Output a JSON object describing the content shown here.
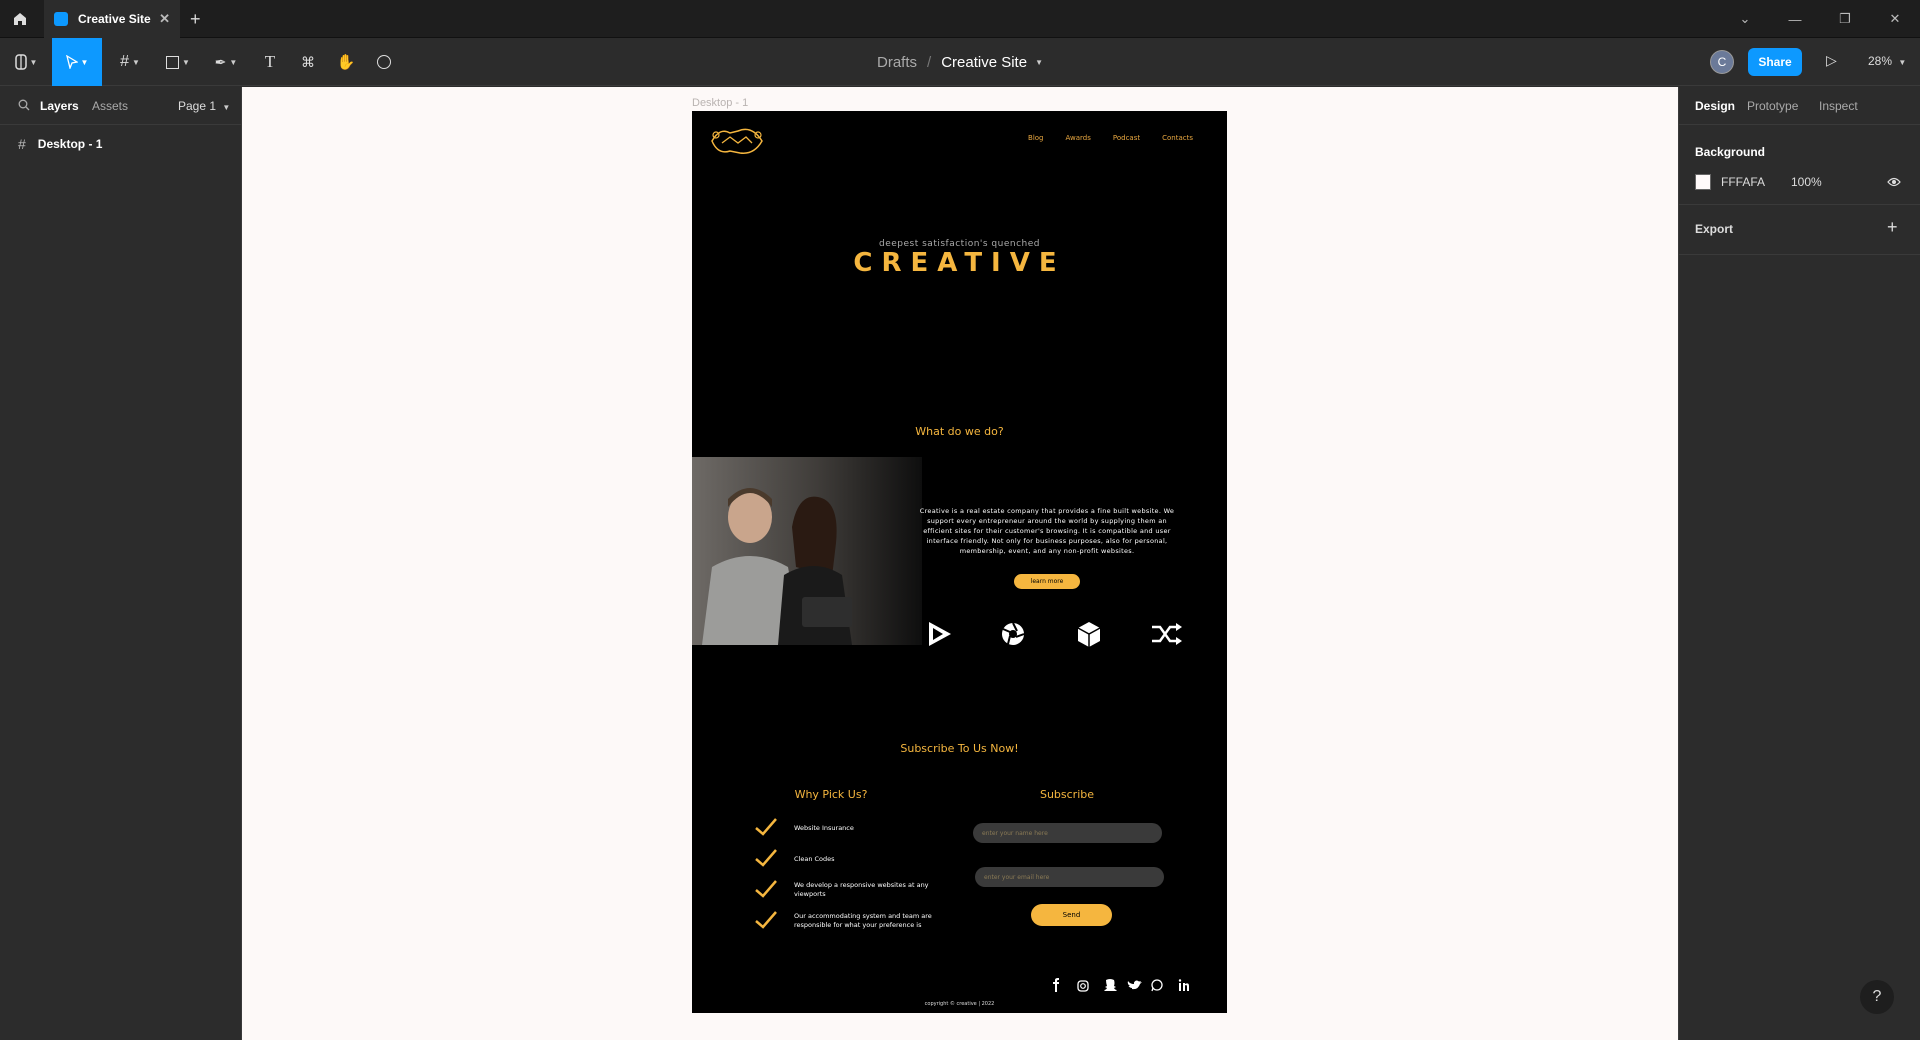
{
  "titlebar": {
    "tab_title": "Creative Site"
  },
  "toolbar": {
    "breadcrumb_drafts": "Drafts",
    "breadcrumb_sep": "/",
    "file_name": "Creative Site",
    "avatar_initial": "C",
    "share_label": "Share",
    "zoom": "28%"
  },
  "left_panel": {
    "tab_layers": "Layers",
    "tab_assets": "Assets",
    "page_label": "Page 1",
    "layers": [
      {
        "name": "Desktop - 1"
      }
    ]
  },
  "right_panel": {
    "tab_design": "Design",
    "tab_prototype": "Prototype",
    "tab_inspect": "Inspect",
    "background_heading": "Background",
    "background_hex": "FFFAFA",
    "background_opacity": "100%",
    "export_heading": "Export"
  },
  "canvas": {
    "frame_label": "Desktop - 1",
    "site": {
      "nav": [
        "Blog",
        "Awards",
        "Podcast",
        "Contacts"
      ],
      "hero_subtitle": "deepest satisfaction's quenched",
      "hero_title": "CREATIVE",
      "what_title": "What do we do?",
      "about_text": "Creative is a real estate company that provides a fine built website. We support every entrepreneur around the world by supplying them an efficient sites for their customer's browsing. It is compatible and user interface friendly. Not only for business purposes, also for personal, membership, event, and any non-profit websites.",
      "learn_more": "learn more",
      "subscribe_now_title": "Subscribe To Us Now!",
      "why_title": "Why Pick Us?",
      "why_items": [
        "Website Insurance",
        "Clean Codes",
        "We develop a responsive websites at any viewports",
        "Our accommodating system and team are responsible for what your preference is"
      ],
      "subscribe_title": "Subscribe",
      "name_placeholder": "enter your name here",
      "email_placeholder": "enter your email here",
      "send_label": "Send",
      "copyright": "copyright © creative | 2022"
    }
  },
  "colors": {
    "accent": "#f5b63f",
    "figma_blue": "#0d99ff",
    "canvas_bg": "#fdf9f8"
  }
}
